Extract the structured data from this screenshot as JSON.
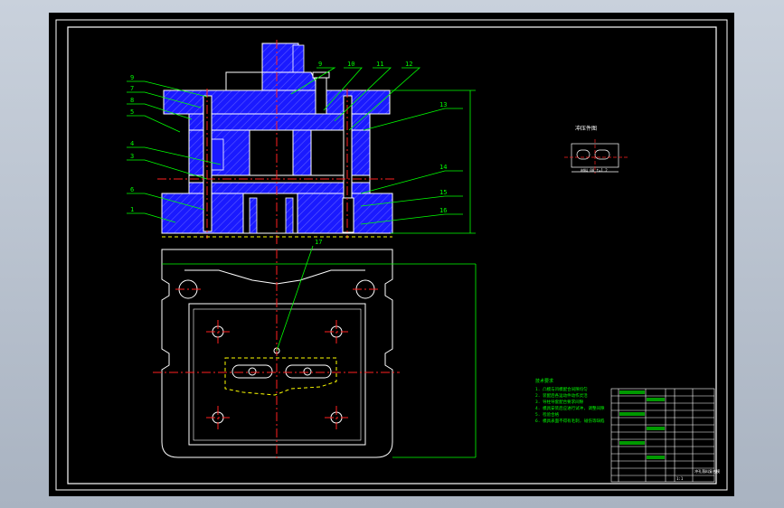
{
  "drawing": {
    "part_labels": [
      "9",
      "7",
      "8",
      "5",
      "4",
      "3",
      "6",
      "1",
      "9",
      "10",
      "11",
      "12",
      "13",
      "14",
      "15",
      "16"
    ],
    "leader_label": "17",
    "detail_title": "冲压件图",
    "detail_note": "材料 08 t=1.2",
    "tech_requirements_title": "技术要求",
    "tech_requirements": [
      "1. 凸模与凹模配合间隙均匀",
      "2. 装配后各运动件动作灵活",
      "3. 导柱导套配合要求间隙",
      "4. 模具安装后应进行试冲, 调整间隙",
      "5. 检验合格",
      "6. 模具表面不得有毛刺, 碰伤等缺陷"
    ]
  },
  "title_block": {
    "school": "",
    "drawing_name": "冲孔落料复合模",
    "scale": "1:1",
    "rows": [
      "",
      "",
      "",
      "",
      "",
      "",
      "",
      "",
      "",
      "",
      "",
      "",
      ""
    ]
  },
  "colors": {
    "background": "#000000",
    "frame": "#ffffff",
    "outline": "#ffffff",
    "hatch": "#1a1aff",
    "center_line": "#ff2020",
    "dimension": "#00ff00",
    "hidden": "#ffff00"
  }
}
